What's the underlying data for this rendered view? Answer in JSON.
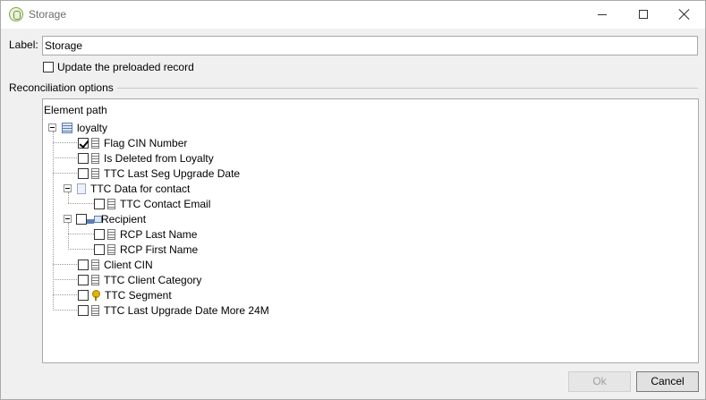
{
  "window": {
    "title": "Storage",
    "minimize": "—",
    "maximize": "☐",
    "close": "✕"
  },
  "form": {
    "label_caption": "Label:",
    "label_value": "Storage",
    "update_preloaded_label": "Update the preloaded record",
    "update_preloaded_checked": false,
    "reconciliation_label": "Reconciliation options"
  },
  "tree": {
    "header": "Element path",
    "nodes": [
      {
        "label": "loyalty",
        "icon": "table-icon",
        "checkbox": false,
        "expander": true
      },
      {
        "label": "Flag CIN Number",
        "icon": "field-icon",
        "checkbox": true,
        "checked": true
      },
      {
        "label": "Is Deleted from Loyalty",
        "icon": "field-icon",
        "checkbox": true,
        "checked": false
      },
      {
        "label": "TTC Last Seg Upgrade Date",
        "icon": "field-icon",
        "checkbox": true,
        "checked": false
      },
      {
        "label": "TTC Data for contact",
        "icon": "page-icon",
        "checkbox": false,
        "expander": true
      },
      {
        "label": "TTC Contact Email",
        "icon": "field-icon",
        "checkbox": true,
        "checked": false
      },
      {
        "label": "Recipient",
        "icon": "link-icon",
        "checkbox": true,
        "checked": false,
        "expander": true
      },
      {
        "label": "RCP Last Name",
        "icon": "field-icon",
        "checkbox": true,
        "checked": false
      },
      {
        "label": "RCP First Name",
        "icon": "field-icon",
        "checkbox": true,
        "checked": false
      },
      {
        "label": "Client CIN",
        "icon": "field-icon",
        "checkbox": true,
        "checked": false
      },
      {
        "label": "TTC Client Category",
        "icon": "field-icon",
        "checkbox": true,
        "checked": false
      },
      {
        "label": "TTC Segment",
        "icon": "key-icon",
        "checkbox": true,
        "checked": false
      },
      {
        "label": "TTC Last Upgrade Date More 24M",
        "icon": "field-icon",
        "checkbox": true,
        "checked": false
      }
    ]
  },
  "buttons": {
    "ok": "Ok",
    "cancel": "Cancel",
    "ok_enabled": false
  }
}
